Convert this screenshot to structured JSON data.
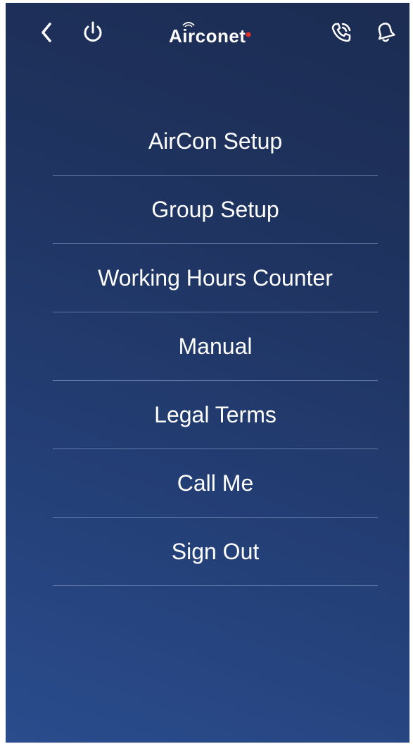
{
  "header": {
    "logo_text": "Airconet",
    "icons": {
      "back": "chevron-left-icon",
      "power": "power-icon",
      "call": "phone-call-icon",
      "notifications": "bell-icon"
    }
  },
  "menu": {
    "items": [
      {
        "label": "AirCon Setup"
      },
      {
        "label": "Group Setup"
      },
      {
        "label": "Working Hours Counter"
      },
      {
        "label": "Manual"
      },
      {
        "label": "Legal Terms"
      },
      {
        "label": "Call Me"
      },
      {
        "label": "Sign Out"
      }
    ]
  },
  "colors": {
    "background_top": "#1c2c52",
    "background_bottom": "#2a4c8c",
    "text": "#ffffff",
    "logo_accent": "#e0312b"
  }
}
